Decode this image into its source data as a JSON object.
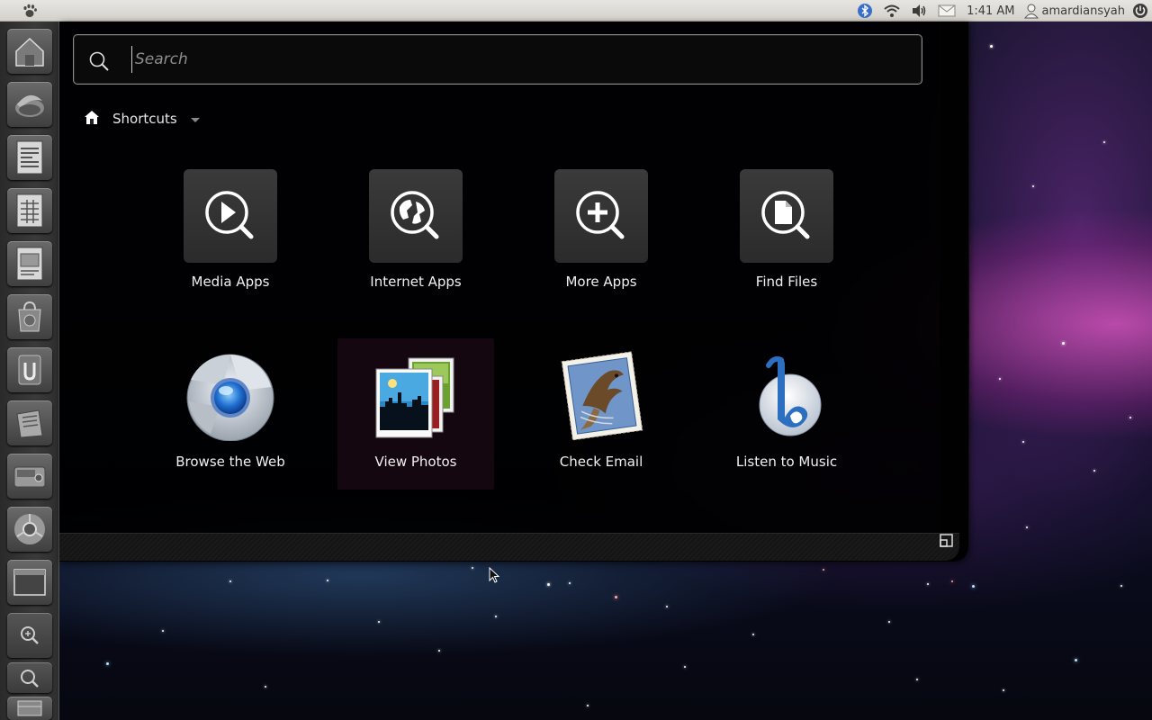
{
  "top_panel": {
    "clock": "1:41 AM",
    "username": "amardiansyah",
    "icons": [
      "gnome-foot-icon",
      "bluetooth-icon",
      "wifi-icon",
      "volume-icon",
      "mail-icon",
      "user-icon",
      "power-icon"
    ]
  },
  "launcher": {
    "items": [
      {
        "name": "home-folder"
      },
      {
        "name": "thunderbird"
      },
      {
        "name": "writer"
      },
      {
        "name": "calc"
      },
      {
        "name": "impress"
      },
      {
        "name": "software-center"
      },
      {
        "name": "ubuntu-one"
      },
      {
        "name": "text-editor"
      },
      {
        "name": "scanner"
      },
      {
        "name": "chromium"
      },
      {
        "name": "workspaces"
      },
      {
        "name": "applications-lens"
      },
      {
        "name": "files-lens"
      },
      {
        "name": "trash"
      }
    ]
  },
  "dash": {
    "search": {
      "placeholder": "Search",
      "value": ""
    },
    "section": {
      "label": "Shortcuts"
    },
    "shortcuts": [
      {
        "label": "Media Apps",
        "icon": "media-apps-icon"
      },
      {
        "label": "Internet Apps",
        "icon": "internet-apps-icon"
      },
      {
        "label": "More Apps",
        "icon": "more-apps-icon"
      },
      {
        "label": "Find Files",
        "icon": "find-files-icon"
      },
      {
        "label": "Browse the Web",
        "icon": "chrome-icon"
      },
      {
        "label": "View Photos",
        "icon": "photos-icon"
      },
      {
        "label": "Check Email",
        "icon": "mail-stamp-icon"
      },
      {
        "label": "Listen to Music",
        "icon": "banshee-icon"
      }
    ]
  },
  "colors": {
    "panel": "#dedbd6",
    "dash_bg": "#000000",
    "text": "#f0f0f0",
    "accent_pink": "#d24fb8"
  }
}
